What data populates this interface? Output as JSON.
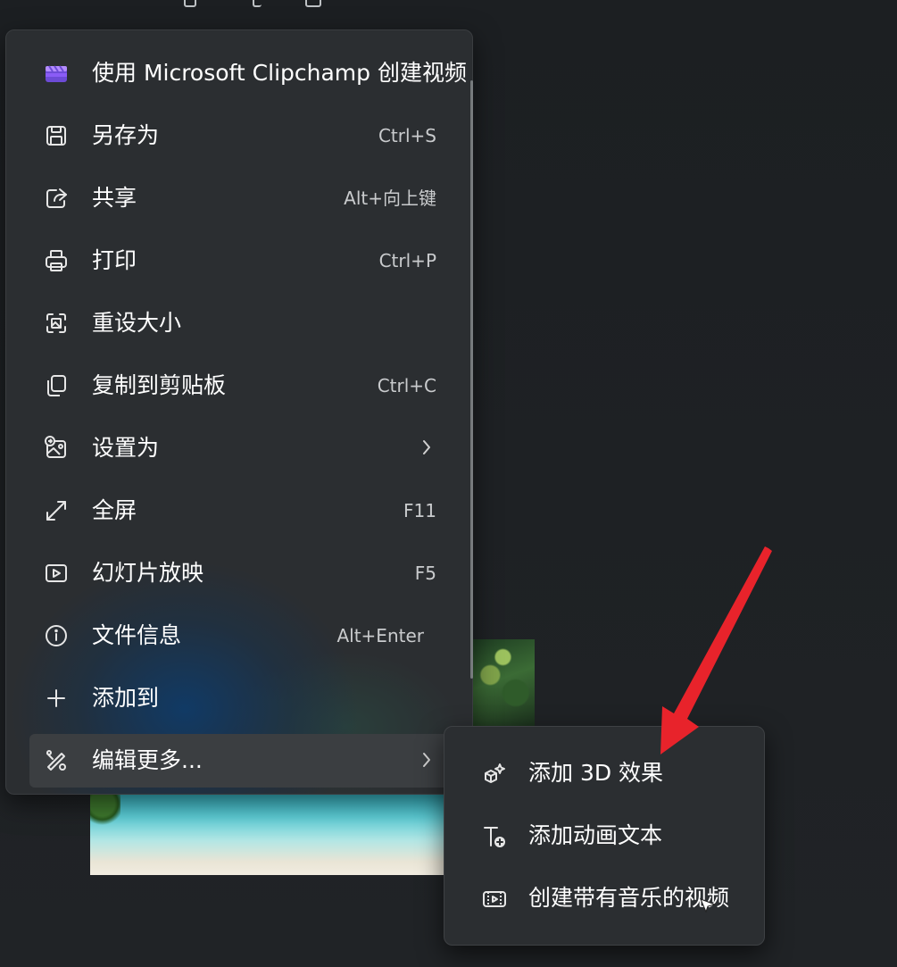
{
  "menu": {
    "items": [
      {
        "label": "使用 Microsoft Clipchamp 创建视频",
        "shortcut": "",
        "icon": "clipchamp-icon"
      },
      {
        "label": "另存为",
        "shortcut": "Ctrl+S",
        "icon": "save-icon"
      },
      {
        "label": "共享",
        "shortcut": "Alt+向上键",
        "icon": "share-icon"
      },
      {
        "label": "打印",
        "shortcut": "Ctrl+P",
        "icon": "print-icon"
      },
      {
        "label": "重设大小",
        "shortcut": "",
        "icon": "resize-icon"
      },
      {
        "label": "复制到剪贴板",
        "shortcut": "Ctrl+C",
        "icon": "copy-icon"
      },
      {
        "label": "设置为",
        "shortcut": "",
        "icon": "set-as-icon",
        "has_submenu": true
      },
      {
        "label": "全屏",
        "shortcut": "F11",
        "icon": "fullscreen-icon"
      },
      {
        "label": "幻灯片放映",
        "shortcut": "F5",
        "icon": "slideshow-icon"
      },
      {
        "label": "文件信息",
        "shortcut": "Alt+Enter",
        "icon": "info-icon"
      },
      {
        "label": "添加到",
        "shortcut": "",
        "icon": "add-icon"
      },
      {
        "label": "编辑更多...",
        "shortcut": "",
        "icon": "edit-more-icon",
        "has_submenu": true,
        "highlighted": true
      }
    ]
  },
  "submenu": {
    "items": [
      {
        "label": "添加 3D 效果",
        "icon": "3d-effects-icon"
      },
      {
        "label": "添加动画文本",
        "icon": "animated-text-icon"
      },
      {
        "label": "创建带有音乐的视频",
        "icon": "video-music-icon"
      }
    ]
  },
  "colors": {
    "menu_background": "#2b2e31",
    "highlight": "#3b3e41",
    "text": "#ffffff",
    "shortcut_text": "#c9cbcd",
    "annotation_arrow": "#e8232b",
    "clipchamp_brand": "#8a5cf6"
  }
}
